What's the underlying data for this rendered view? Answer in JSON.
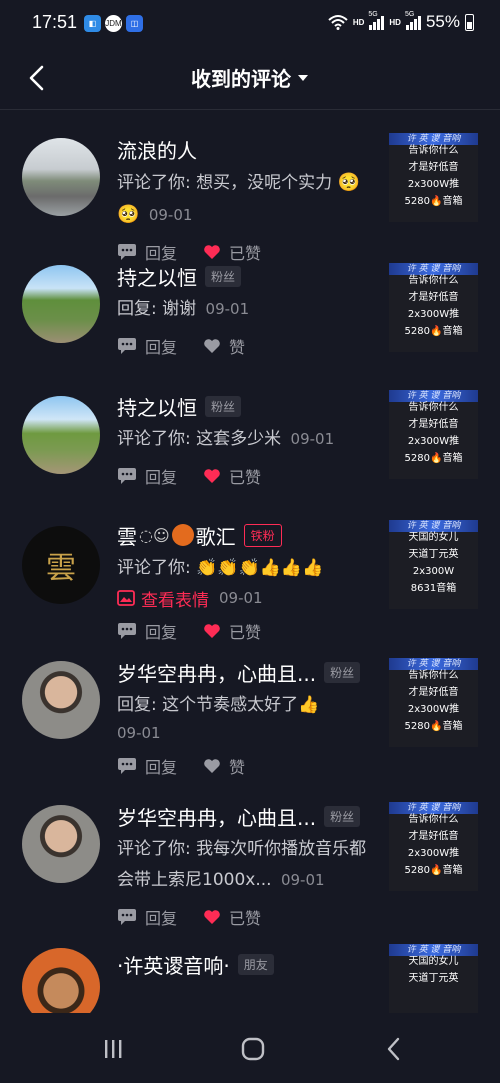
{
  "status_bar": {
    "time": "17:51",
    "net_hd_1": "HD",
    "net_5g_1": "5G",
    "net_hd_2": "HD",
    "net_5g_2": "5G",
    "battery": "55%",
    "notif_icons": [
      "app-notification-icon",
      "jdm-icon",
      "shield-app-icon"
    ]
  },
  "header": {
    "title": "收到的评论"
  },
  "thumb_texts": {
    "a": [
      "告诉你什么",
      "才是好低音",
      "2x300W推",
      "5280🔥音箱"
    ],
    "b": [
      "天国的女儿",
      "天道丁元英",
      "2x300W",
      "8631音箱"
    ],
    "band": "许 英 谡 音响"
  },
  "comments": [
    {
      "name": "流浪的人",
      "tag": "",
      "text": "评论了你: 想买，没呢个实力",
      "emoji": "🥺🥺",
      "time": "09-01",
      "reply_label": "回复",
      "like_label": "已赞",
      "liked": true
    },
    {
      "name": "持之以恒",
      "tag": "粉丝",
      "text": "回复: 谢谢",
      "time": "09-01",
      "reply_label": "回复",
      "like_label": "赞",
      "liked": false
    },
    {
      "name": "持之以恒",
      "tag": "粉丝",
      "text": "评论了你: 这套多少米",
      "time": "09-01",
      "reply_label": "回复",
      "like_label": "已赞",
      "liked": true
    },
    {
      "name": "雲",
      "name_tail": "歌汇",
      "tag": "铁粉",
      "text": "评论了你: ",
      "emoji": "👏👏👏👍👍👍",
      "sticker_label": "查看表情",
      "time": "09-01",
      "reply_label": "回复",
      "like_label": "已赞",
      "liked": true
    },
    {
      "name": "岁华空冉冉，心曲且...",
      "tag": "粉丝",
      "text": "回复: 这个节奏感太好了",
      "emoji": "👍",
      "time": "09-01",
      "reply_label": "回复",
      "like_label": "赞",
      "liked": false
    },
    {
      "name": "岁华空冉冉，心曲且...",
      "tag": "粉丝",
      "text": "评论了你: 我每次听你播放音乐都会带上索尼1000x...",
      "time": "09-01",
      "reply_label": "回复",
      "like_label": "已赞",
      "liked": true
    },
    {
      "name": "·许英谡音响·",
      "tag": "朋友"
    }
  ],
  "colors": {
    "accent": "#fe2c55",
    "bg": "#161823"
  }
}
